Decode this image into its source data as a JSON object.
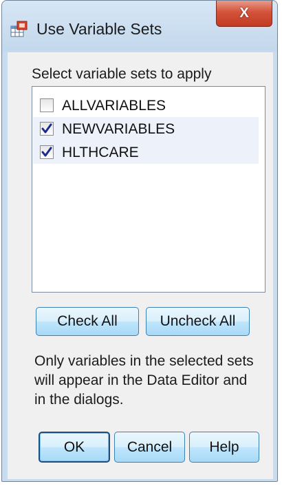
{
  "window": {
    "title": "Use Variable Sets",
    "close_glyph": "X"
  },
  "variable_sets": {
    "prompt": "Select variable sets to apply",
    "items": [
      {
        "label": "ALLVARIABLES",
        "checked": false
      },
      {
        "label": "NEWVARIABLES",
        "checked": true
      },
      {
        "label": "HLTHCARE",
        "checked": true
      }
    ]
  },
  "buttons": {
    "check_all": "Check All",
    "uncheck_all": "Uncheck All",
    "ok": "OK",
    "cancel": "Cancel",
    "help": "Help"
  },
  "info": "Only variables in the selected sets will appear in the Data Editor and in the dialogs.",
  "icons": {
    "app": "variable-sets-icon",
    "close": "close-icon",
    "check": "checkmark-icon"
  },
  "colors": {
    "close_button": "#c23a22",
    "button_border": "#3c7fb1",
    "checkmark": "#1c2a8c"
  }
}
